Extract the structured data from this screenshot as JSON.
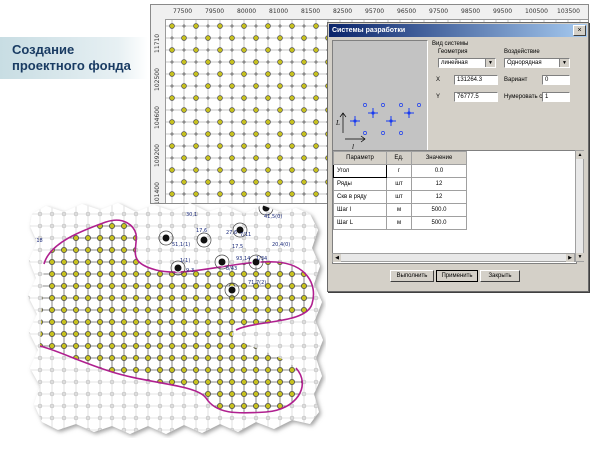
{
  "slide": {
    "title": "Создание проектного фонда"
  },
  "map": {
    "x_ticks": [
      "77500",
      "79500",
      "80000",
      "81000",
      "81500",
      "82500",
      "95700",
      "96500",
      "97500",
      "98500",
      "99500",
      "100500",
      "103500"
    ],
    "y_ticks": [
      "11710",
      "102500",
      "104600",
      "109200",
      "101400"
    ],
    "labels": [
      "30,1",
      "17,6",
      "51,1(1)",
      "7/11",
      "27,6",
      "41,5(0)",
      "17,5",
      "20,4(0)",
      "1(1)",
      "9-3",
      "8/43",
      "1/34",
      "93,14",
      "71,7(2)",
      "3618"
    ]
  },
  "dialog": {
    "title": "Системы разработки",
    "close": "×",
    "group_label": "Вид системы",
    "geometry_label": "Геометрия",
    "geometry_value": "линейная",
    "impact_label": "Воздействие",
    "impact_value": "Однорядная",
    "x_label": "X",
    "x_value": "131264.3",
    "y_label": "Y",
    "y_value": "76777.5",
    "variant_label": "Вариант",
    "variant_value": "0",
    "numbering_label": "Нумеровать с",
    "numbering_value": "1",
    "preview_axis_l": "L",
    "preview_axis_t": "l",
    "table": {
      "headers": [
        "Параметр",
        "Ед.",
        "Значение"
      ],
      "rows": [
        {
          "param": "Угол",
          "unit": "г",
          "value": "0.0"
        },
        {
          "param": "Ряды",
          "unit": "шт",
          "value": "12"
        },
        {
          "param": "Скв в ряду",
          "unit": "шт",
          "value": "12"
        },
        {
          "param": "Шаг l",
          "unit": "м",
          "value": "500.0"
        },
        {
          "param": "Шаг L",
          "unit": "м",
          "value": "500.0"
        }
      ]
    },
    "buttons": {
      "run": "Выполнить",
      "apply": "Применить",
      "close": "Закрыть"
    }
  },
  "colors": {
    "well_fill": "#c8c21e",
    "well_ring": "#4b4b4b",
    "boundary": "#b0208f",
    "cross": "#555555",
    "titlebar": "#0a246a"
  }
}
